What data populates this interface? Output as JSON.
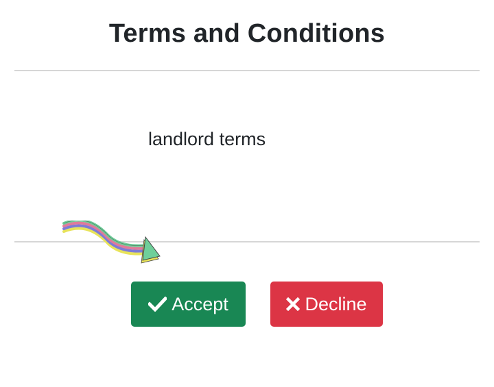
{
  "modal": {
    "title": "Terms and Conditions",
    "body_text": "landlord terms"
  },
  "footer": {
    "accept_label": "Accept",
    "accept_icon": "check-icon",
    "accept_color": "#198754",
    "decline_label": "Decline",
    "decline_icon": "close-icon",
    "decline_color": "#dc3545"
  },
  "annotation": {
    "icon": "arrow-icon"
  }
}
